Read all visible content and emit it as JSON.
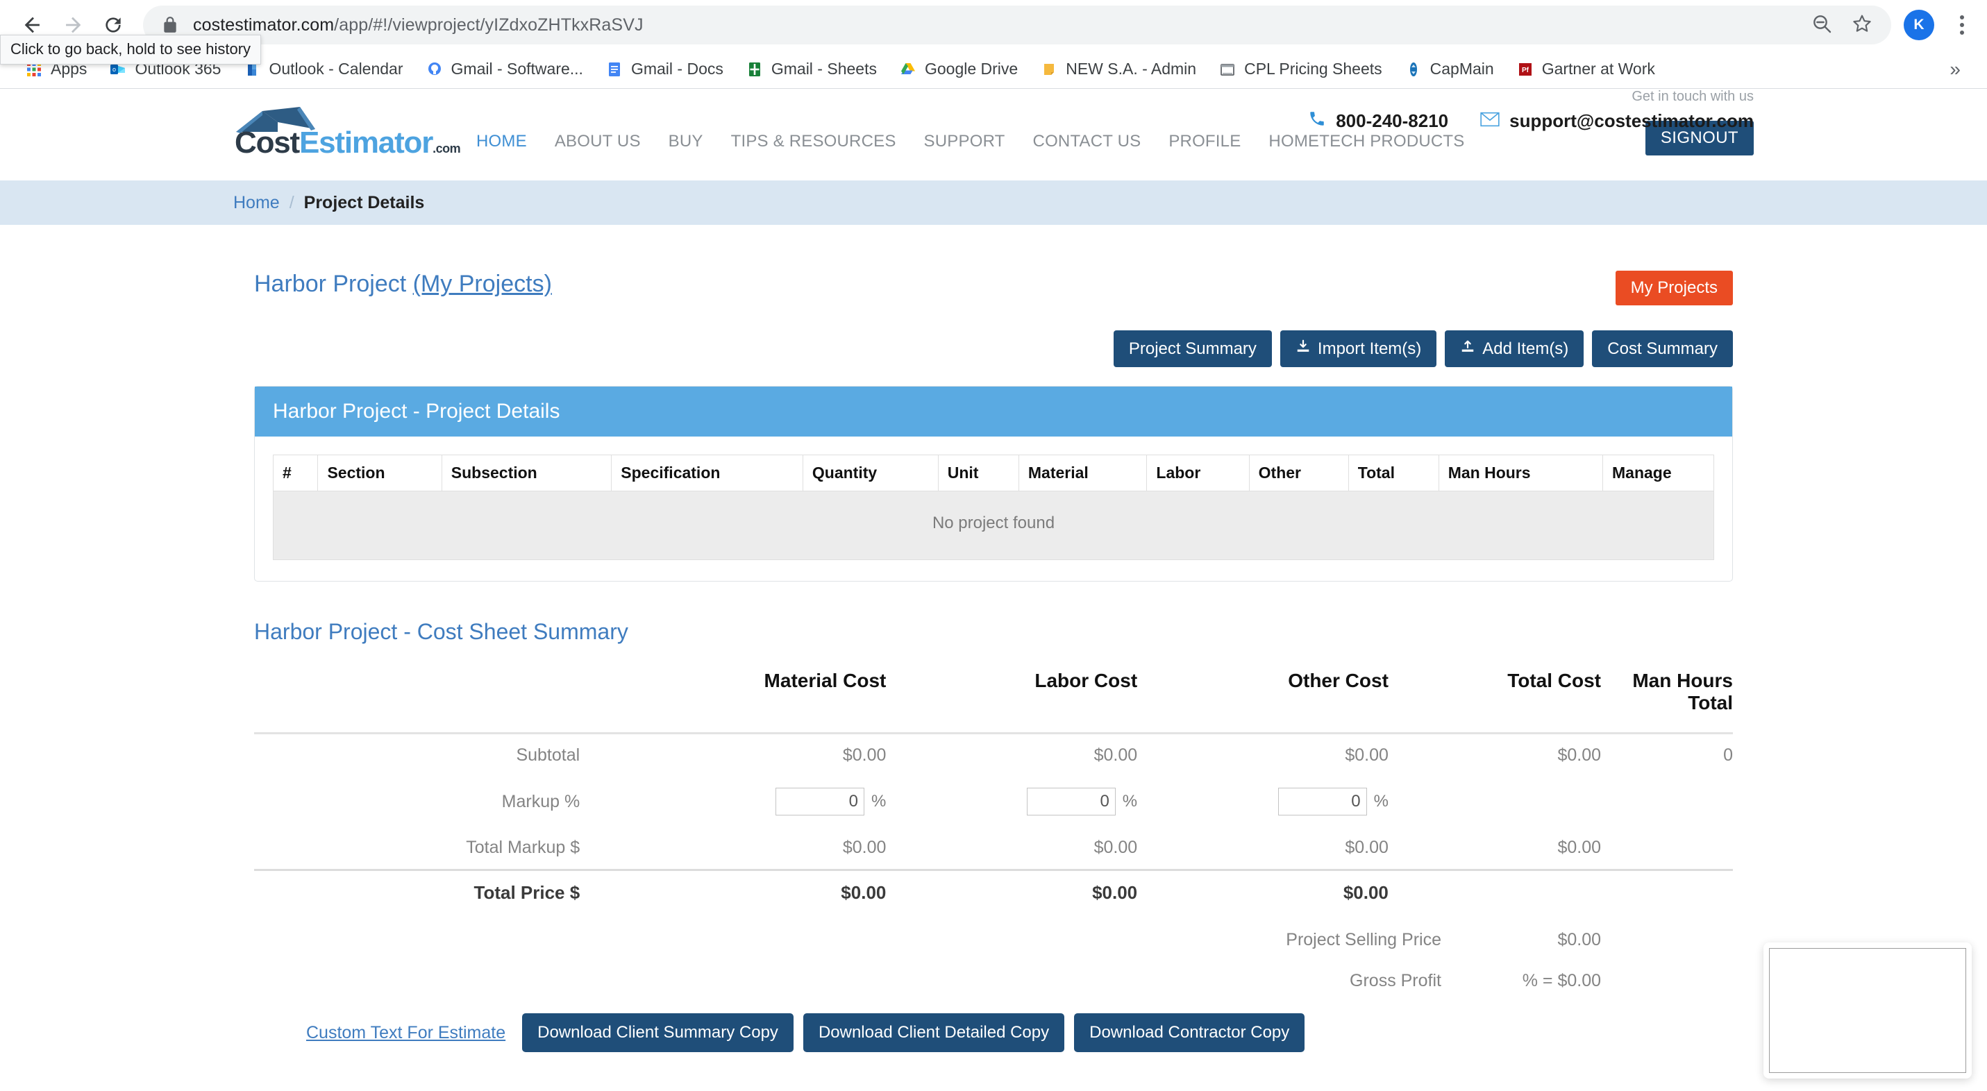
{
  "browser": {
    "url_host": "costestimator.com",
    "url_path": "/app/#!/viewproject/yIZdxoZHTkxRaSVJ",
    "back_tooltip": "Click to go back, hold to see history",
    "avatar_initial": "K",
    "bookmarks": [
      {
        "label": "Apps",
        "icon": "apps-grid-icon"
      },
      {
        "label": "Outlook 365",
        "icon": "outlook-icon"
      },
      {
        "label": "Outlook - Calendar",
        "icon": "outlook-calendar-icon"
      },
      {
        "label": "Gmail - Software...",
        "icon": "gmail-software-icon"
      },
      {
        "label": "Gmail - Docs",
        "icon": "google-docs-icon"
      },
      {
        "label": "Gmail - Sheets",
        "icon": "google-sheets-icon"
      },
      {
        "label": "Google Drive",
        "icon": "google-drive-icon"
      },
      {
        "label": "NEW S.A. - Admin",
        "icon": "keep-note-icon"
      },
      {
        "label": "CPL Pricing Sheets",
        "icon": "folder-icon"
      },
      {
        "label": "CapMain",
        "icon": "capmain-icon"
      },
      {
        "label": "Gartner at Work",
        "icon": "gartner-icon"
      }
    ],
    "overflow_label": "»"
  },
  "site_header": {
    "logo": {
      "part1": "Cost",
      "part2": "Estimator",
      "suffix": ".com"
    },
    "nav": [
      {
        "label": "HOME",
        "active": true
      },
      {
        "label": "ABOUT US",
        "active": false
      },
      {
        "label": "BUY",
        "active": false
      },
      {
        "label": "TIPS & RESOURCES",
        "active": false
      },
      {
        "label": "SUPPORT",
        "active": false
      },
      {
        "label": "CONTACT US",
        "active": false
      },
      {
        "label": "PROFILE",
        "active": false
      },
      {
        "label": "HOMETECH PRODUCTS",
        "active": false
      }
    ],
    "signout_label": "SIGNOUT",
    "get_in_touch": "Get in touch with us",
    "phone": "800-240-8210",
    "email": "support@costestimator.com"
  },
  "breadcrumb": {
    "home": "Home",
    "divider": "/",
    "current": "Project Details"
  },
  "page": {
    "project_name": "Harbor Project",
    "my_projects_link": "(My Projects)",
    "my_projects_button": "My Projects",
    "actions": [
      {
        "label": "Project Summary",
        "icon": null
      },
      {
        "label": "Import Item(s)",
        "icon": "download-icon"
      },
      {
        "label": "Add Item(s)",
        "icon": "upload-icon"
      },
      {
        "label": "Cost Summary",
        "icon": null
      }
    ]
  },
  "details_panel": {
    "heading": "Harbor Project - Project Details",
    "columns": [
      "#",
      "Section",
      "Subsection",
      "Specification",
      "Quantity",
      "Unit",
      "Material",
      "Labor",
      "Other",
      "Total",
      "Man Hours",
      "Manage"
    ],
    "empty_message": "No project found"
  },
  "cost_summary": {
    "heading": "Harbor Project - Cost Sheet Summary",
    "columns": [
      "Material Cost",
      "Labor Cost",
      "Other Cost",
      "Total Cost",
      "Man Hours Total"
    ],
    "man_hours_line1": "Man Hours",
    "man_hours_line2": "Total",
    "rows": {
      "subtotal": {
        "label": "Subtotal",
        "material": "$0.00",
        "labor": "$0.00",
        "other": "$0.00",
        "total": "$0.00",
        "man_hours": "0"
      },
      "markup": {
        "label": "Markup %",
        "material_value": "0",
        "labor_value": "0",
        "other_value": "0",
        "percent_symbol": "%"
      },
      "total_markup": {
        "label": "Total Markup $",
        "material": "$0.00",
        "labor": "$0.00",
        "other": "$0.00",
        "total": "$0.00"
      },
      "total_price": {
        "label": "Total Price $",
        "material": "$0.00",
        "labor": "$0.00",
        "other": "$0.00"
      }
    },
    "selling_price_label": "Project Selling Price",
    "selling_price_value": "$0.00",
    "gross_profit_label": "Gross Profit",
    "gross_profit_value": "%  = $0.00"
  },
  "bottom_actions": {
    "custom_text_link": "Custom Text For Estimate",
    "buttons": [
      "Download Client Summary Copy",
      "Download Client Detailed Copy",
      "Download Contractor Copy"
    ]
  },
  "colors": {
    "brand_dark_blue": "#1f4e79",
    "panel_blue": "#5aaae2",
    "accent_orange": "#ea4c23",
    "link_blue": "#3f7cbf",
    "breadcrumb_bg": "#d9e6f2"
  }
}
